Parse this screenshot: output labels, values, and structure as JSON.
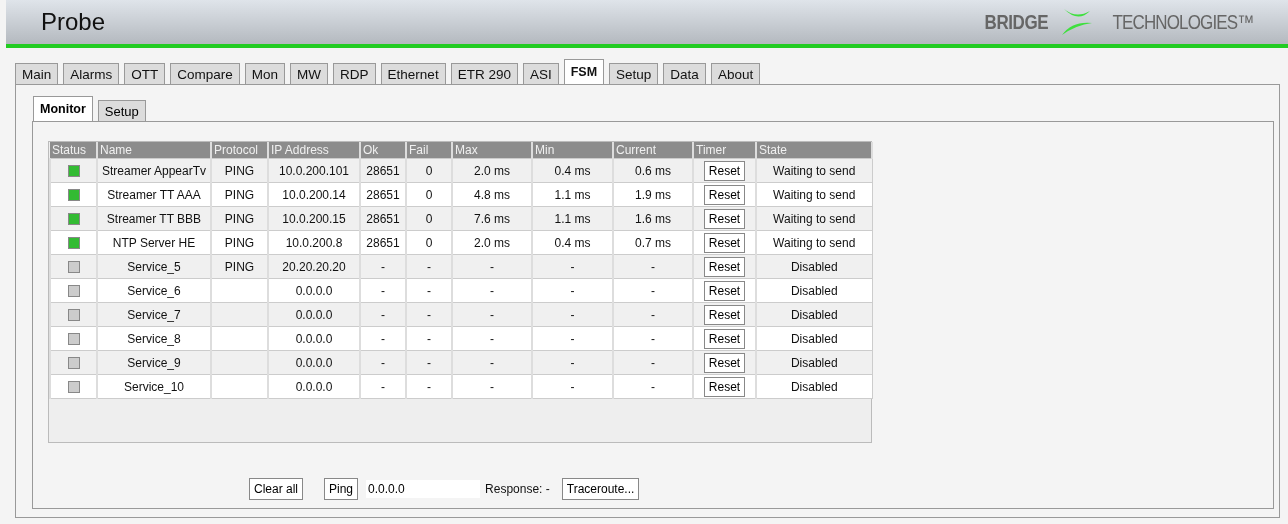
{
  "header": {
    "title": "Probe",
    "logo": {
      "brand_bold": "BRIDGE",
      "brand_light": "TECHNOLOGIES™"
    }
  },
  "tabs": [
    {
      "label": "Main",
      "selected": false
    },
    {
      "label": "Alarms",
      "selected": false
    },
    {
      "label": "OTT",
      "selected": false
    },
    {
      "label": "Compare",
      "selected": false
    },
    {
      "label": "Mon",
      "selected": false
    },
    {
      "label": "MW",
      "selected": false
    },
    {
      "label": "RDP",
      "selected": false
    },
    {
      "label": "Ethernet",
      "selected": false
    },
    {
      "label": "ETR 290",
      "selected": false
    },
    {
      "label": "ASI",
      "selected": false
    },
    {
      "label": "FSM",
      "selected": true
    },
    {
      "label": "Setup",
      "selected": false
    },
    {
      "label": "Data",
      "selected": false
    },
    {
      "label": "About",
      "selected": false
    }
  ],
  "subtabs": [
    {
      "label": "Monitor",
      "selected": true
    },
    {
      "label": "Setup",
      "selected": false
    }
  ],
  "table": {
    "columns": [
      "Status",
      "Name",
      "Protocol",
      "IP Address",
      "Ok",
      "Fail",
      "Max",
      "Min",
      "Current",
      "Timer",
      "State"
    ],
    "rows": [
      {
        "active": true,
        "name": "Streamer AppearTv",
        "protocol": "PING",
        "ip": "10.0.200.101",
        "ok": "28651",
        "fail": "0",
        "max": "2.0 ms",
        "min": "0.4 ms",
        "current": "0.6 ms",
        "timer": "Reset",
        "state": "Waiting to send"
      },
      {
        "active": true,
        "name": "Streamer TT AAA",
        "protocol": "PING",
        "ip": "10.0.200.14",
        "ok": "28651",
        "fail": "0",
        "max": "4.8 ms",
        "min": "1.1 ms",
        "current": "1.9 ms",
        "timer": "Reset",
        "state": "Waiting to send"
      },
      {
        "active": true,
        "name": "Streamer TT BBB",
        "protocol": "PING",
        "ip": "10.0.200.15",
        "ok": "28651",
        "fail": "0",
        "max": "7.6 ms",
        "min": "1.1 ms",
        "current": "1.6 ms",
        "timer": "Reset",
        "state": "Waiting to send"
      },
      {
        "active": true,
        "name": "NTP Server HE",
        "protocol": "PING",
        "ip": "10.0.200.8",
        "ok": "28651",
        "fail": "0",
        "max": "2.0 ms",
        "min": "0.4 ms",
        "current": "0.7 ms",
        "timer": "Reset",
        "state": "Waiting to send"
      },
      {
        "active": false,
        "name": "Service_5",
        "protocol": "PING",
        "ip": "20.20.20.20",
        "ok": "-",
        "fail": "-",
        "max": "-",
        "min": "-",
        "current": "-",
        "timer": "Reset",
        "state": "Disabled"
      },
      {
        "active": false,
        "name": "Service_6",
        "ip": "0.0.0.0",
        "ok": "-",
        "fail": "-",
        "max": "-",
        "min": "-",
        "current": "-",
        "timer": "Reset",
        "state": "Disabled"
      },
      {
        "active": false,
        "name": "Service_7",
        "ip": "0.0.0.0",
        "ok": "-",
        "fail": "-",
        "max": "-",
        "min": "-",
        "current": "-",
        "timer": "Reset",
        "state": "Disabled"
      },
      {
        "active": false,
        "name": "Service_8",
        "ip": "0.0.0.0",
        "ok": "-",
        "fail": "-",
        "max": "-",
        "min": "-",
        "current": "-",
        "timer": "Reset",
        "state": "Disabled"
      },
      {
        "active": false,
        "name": "Service_9",
        "ip": "0.0.0.0",
        "ok": "-",
        "fail": "-",
        "max": "-",
        "min": "-",
        "current": "-",
        "timer": "Reset",
        "state": "Disabled"
      },
      {
        "active": false,
        "name": "Service_10",
        "ip": "0.0.0.0",
        "ok": "-",
        "fail": "-",
        "max": "-",
        "min": "-",
        "current": "-",
        "timer": "Reset",
        "state": "Disabled"
      }
    ]
  },
  "controls": {
    "clear_button": "Clear all",
    "ping_button": "Ping",
    "ping_address": "0.0.0.0",
    "response_label": "Response: -",
    "traceroute_button": "Traceroute..."
  }
}
